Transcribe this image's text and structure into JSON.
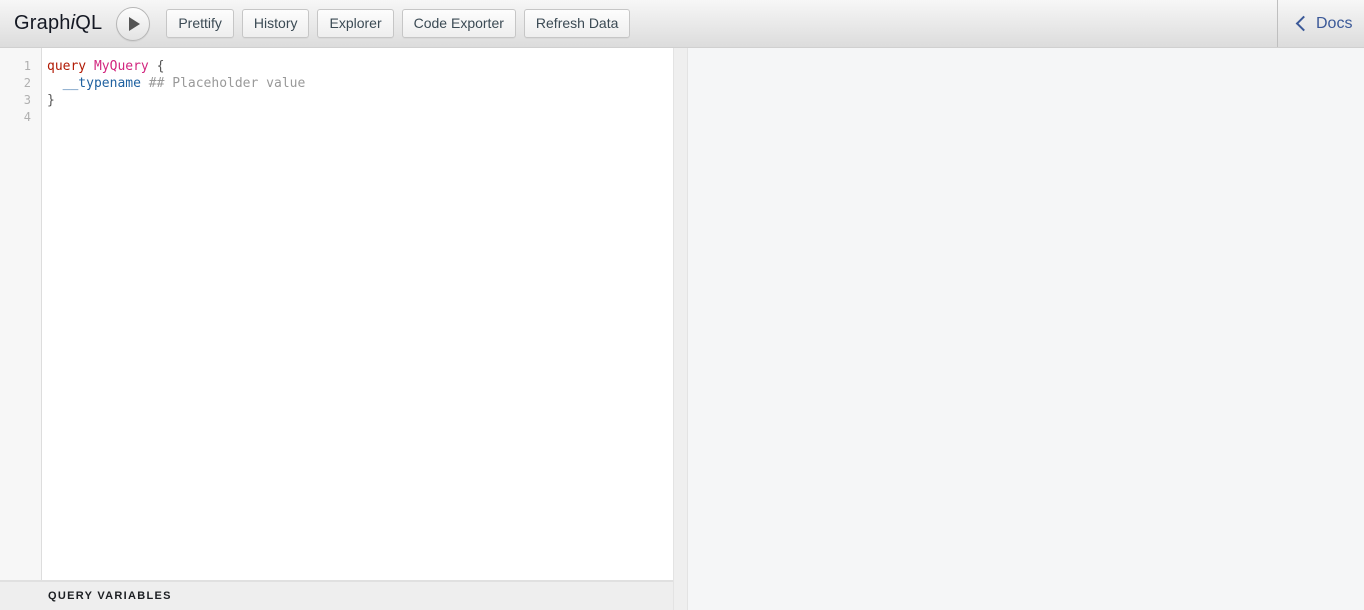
{
  "app": {
    "logo_main": "Graph",
    "logo_em": "i",
    "logo_tail": "QL"
  },
  "toolbar": {
    "execute_icon": "play-triangle-icon",
    "buttons": [
      {
        "label": "Prettify",
        "name": "prettify-button"
      },
      {
        "label": "History",
        "name": "history-button"
      },
      {
        "label": "Explorer",
        "name": "explorer-button"
      },
      {
        "label": "Code Exporter",
        "name": "code-exporter-button"
      },
      {
        "label": "Refresh Data",
        "name": "refresh-data-button"
      }
    ],
    "docs": {
      "label": "Docs",
      "icon": "chevron-left-icon"
    }
  },
  "query_editor": {
    "line_numbers": [
      "1",
      "2",
      "3",
      "4"
    ],
    "lines": [
      {
        "tokens": [
          {
            "text": "query",
            "type": "kw"
          },
          {
            "text": " ",
            "type": "punct"
          },
          {
            "text": "MyQuery",
            "type": "def"
          },
          {
            "text": " {",
            "type": "punct"
          }
        ]
      },
      {
        "tokens": [
          {
            "text": "  ",
            "type": "punct"
          },
          {
            "text": "__typename",
            "type": "field"
          },
          {
            "text": " ",
            "type": "punct"
          },
          {
            "text": "## Placeholder value",
            "type": "comment"
          }
        ]
      },
      {
        "tokens": [
          {
            "text": "}",
            "type": "punct"
          }
        ]
      },
      {
        "tokens": []
      }
    ],
    "plain_text": "query MyQuery {\n  __typename ## Placeholder value\n}\n"
  },
  "query_variables": {
    "title": "QUERY VARIABLES",
    "value": ""
  },
  "result_pane": {
    "value": ""
  },
  "colors": {
    "toolbar_top": "#f7f7f7",
    "toolbar_bottom": "#dcdcdc",
    "docs_link": "#3b5998",
    "keyword": "#b11a04",
    "definition": "#d2267f",
    "field": "#1f61a0",
    "comment": "#999999",
    "result_background": "#f5f6f7",
    "gutter_background": "#f7f7f7"
  }
}
